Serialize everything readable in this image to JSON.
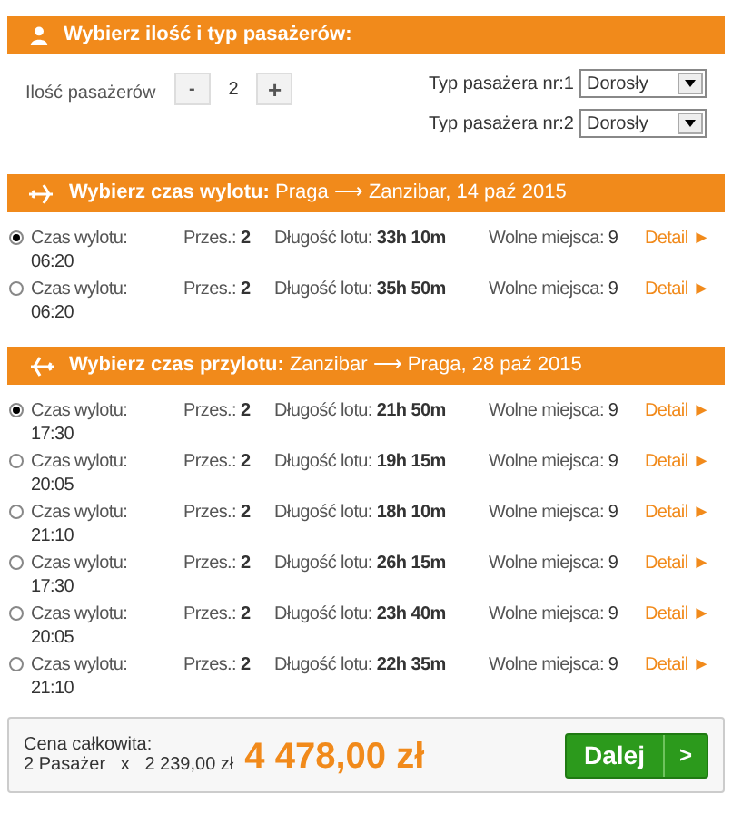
{
  "passengers": {
    "title": "Wybierz ilość i typ pasażerów:",
    "count_label": "Ilość pasażerów",
    "minus": "-",
    "count": "2",
    "plus": "+",
    "types": [
      {
        "label": "Typ pasażera nr:1",
        "value": "Dorosły"
      },
      {
        "label": "Typ pasażera nr:2",
        "value": "Dorosły"
      }
    ]
  },
  "sections": [
    {
      "kind": "departure",
      "title": "**Wybierz czas wylotu:** Praga ⟶ Zanzibar, 14 paź 2015",
      "flights": [
        {
          "selected": true,
          "time_label": "Czas wylotu:",
          "time": "06:20",
          "stops_label": "Przes.:",
          "stops": "2",
          "duration_label": "Długość lotu:",
          "duration": "33h 10m",
          "seats_label": "Wolne miejsca:",
          "seats": "9",
          "detail": "Detail ►"
        },
        {
          "selected": false,
          "time_label": "Czas wylotu:",
          "time": "06:20",
          "stops_label": "Przes.:",
          "stops": "2",
          "duration_label": "Długość lotu:",
          "duration": "35h 50m",
          "seats_label": "Wolne miejsca:",
          "seats": "9",
          "detail": "Detail ►"
        }
      ]
    },
    {
      "kind": "return",
      "title": "**Wybierz czas przylotu:** Zanzibar ⟶ Praga, 28 paź 2015",
      "flights": [
        {
          "selected": true,
          "time_label": "Czas wylotu:",
          "time": "17:30",
          "stops_label": "Przes.:",
          "stops": "2",
          "duration_label": "Długość lotu:",
          "duration": "21h 50m",
          "seats_label": "Wolne miejsca:",
          "seats": "9",
          "detail": "Detail ►"
        },
        {
          "selected": false,
          "time_label": "Czas wylotu:",
          "time": "20:05",
          "stops_label": "Przes.:",
          "stops": "2",
          "duration_label": "Długość lotu:",
          "duration": "19h 15m",
          "seats_label": "Wolne miejsca:",
          "seats": "9",
          "detail": "Detail ►"
        },
        {
          "selected": false,
          "time_label": "Czas wylotu:",
          "time": "21:10",
          "stops_label": "Przes.:",
          "stops": "2",
          "duration_label": "Długość lotu:",
          "duration": "18h 10m",
          "seats_label": "Wolne miejsca:",
          "seats": "9",
          "detail": "Detail ►"
        },
        {
          "selected": false,
          "time_label": "Czas wylotu:",
          "time": "17:30",
          "stops_label": "Przes.:",
          "stops": "2",
          "duration_label": "Długość lotu:",
          "duration": "26h 15m",
          "seats_label": "Wolne miejsca:",
          "seats": "9",
          "detail": "Detail ►"
        },
        {
          "selected": false,
          "time_label": "Czas wylotu:",
          "time": "20:05",
          "stops_label": "Przes.:",
          "stops": "2",
          "duration_label": "Długość lotu:",
          "duration": "23h 40m",
          "seats_label": "Wolne miejsca:",
          "seats": "9",
          "detail": "Detail ►"
        },
        {
          "selected": false,
          "time_label": "Czas wylotu:",
          "time": "21:10",
          "stops_label": "Przes.:",
          "stops": "2",
          "duration_label": "Długość lotu:",
          "duration": "22h 35m",
          "seats_label": "Wolne miejsca:",
          "seats": "9",
          "detail": "Detail ►"
        }
      ]
    }
  ],
  "total": {
    "label": "Cena całkowita:",
    "passengers": "2 Pasażer",
    "times": "x",
    "unit_price": "2 239,00 zł",
    "amount": "4 478,00 zł",
    "next": "Dalej",
    "next_arrow": ">"
  }
}
